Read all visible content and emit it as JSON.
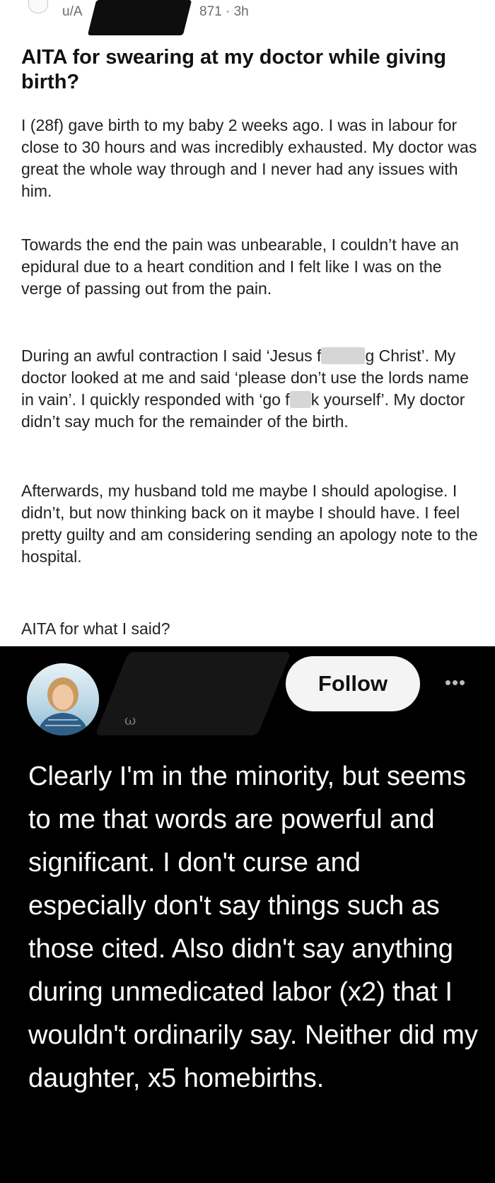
{
  "post": {
    "username": "u/A",
    "username_tail": "871",
    "time": "· 3h",
    "title": "AITA for swearing at my doctor while giving birth?",
    "p1": "I (28f) gave birth to my baby 2 weeks ago. I was in labour for close to 30 hours and was incredibly exhausted. My doctor was great the whole way through and I never had any issues with him.",
    "p2": "Towards the end the pain was unbearable, I couldn’t have an epidural due to a heart condition and I felt like I was on the verge of passing out from the pain.",
    "p3_a": "During an awful contraction I said ‘Jesus f",
    "p3_b": "g Christ’. My doctor looked at me and said ‘please don’t use the lords name in vain’. I quickly responded with ‘go f",
    "p3_c": "k yourself’. My doctor didn’t say much for the remainder of the birth.",
    "p4": "Afterwards, my husband told me maybe I should apologise. I didn’t, but now thinking back on it maybe I should have. I feel pretty guilty and am considering sending an apology note to the hospital.",
    "p5": "AITA for what I said?"
  },
  "comment": {
    "handle_hint": "ω",
    "follow_label": "Follow",
    "more_label": "•••",
    "text": "Clearly I'm in the minority, but seems to me that words are powerful and significant. I don't curse and especially don't say things such as those cited. Also didn't say anything during unmedicated labor (x2) that I wouldn't ordinarily say. Neither did my daughter, x5 homebirths."
  },
  "icons": [
    "subreddit-icon",
    "avatar-photo",
    "more-options-icon"
  ],
  "colors": {
    "post_bg": "#ffffff",
    "comment_bg": "#000000",
    "follow_bg": "#f4f4f4"
  }
}
